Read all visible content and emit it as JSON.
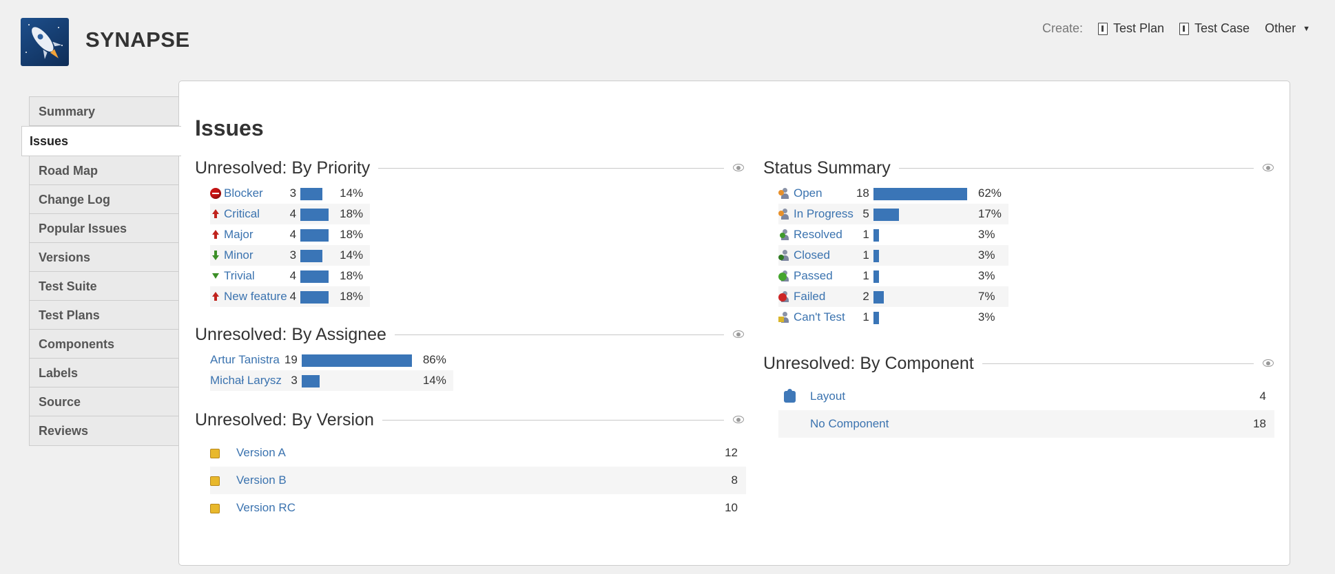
{
  "header": {
    "app_title": "SYNAPSE",
    "create_label": "Create:",
    "create_items": [
      {
        "label": "Test Plan",
        "icon": "document-icon"
      },
      {
        "label": "Test Case",
        "icon": "document-icon"
      }
    ],
    "other_label": "Other"
  },
  "sidebar": {
    "items": [
      {
        "label": "Summary"
      },
      {
        "label": "Issues",
        "active": true
      },
      {
        "label": "Road Map"
      },
      {
        "label": "Change Log"
      },
      {
        "label": "Popular Issues"
      },
      {
        "label": "Versions"
      },
      {
        "label": "Test Suite"
      },
      {
        "label": "Test Plans"
      },
      {
        "label": "Components"
      },
      {
        "label": "Labels"
      },
      {
        "label": "Source"
      },
      {
        "label": "Reviews"
      }
    ]
  },
  "main": {
    "title": "Issues",
    "by_priority": {
      "title": "Unresolved: By Priority",
      "rows": [
        {
          "label": "Blocker",
          "icon": "blocker-icon",
          "count": "3",
          "pct": "14%",
          "fraction": 0.14
        },
        {
          "label": "Critical",
          "icon": "critical-icon",
          "count": "4",
          "pct": "18%",
          "fraction": 0.18
        },
        {
          "label": "Major",
          "icon": "major-icon",
          "count": "4",
          "pct": "18%",
          "fraction": 0.18
        },
        {
          "label": "Minor",
          "icon": "minor-icon",
          "count": "3",
          "pct": "14%",
          "fraction": 0.14
        },
        {
          "label": "Trivial",
          "icon": "trivial-icon",
          "count": "4",
          "pct": "18%",
          "fraction": 0.18
        },
        {
          "label": "New feature",
          "icon": "new-feature-icon",
          "count": "4",
          "pct": "18%",
          "fraction": 0.18
        }
      ]
    },
    "by_assignee": {
      "title": "Unresolved: By Assignee",
      "rows": [
        {
          "label": "Artur Tanistra",
          "count": "19",
          "pct": "86%",
          "fraction": 0.86
        },
        {
          "label": "Michał Larysz",
          "count": "3",
          "pct": "14%",
          "fraction": 0.14
        }
      ]
    },
    "by_version": {
      "title": "Unresolved: By Version",
      "rows": [
        {
          "label": "Version A",
          "count": "12"
        },
        {
          "label": "Version B",
          "count": "8"
        },
        {
          "label": "Version RC",
          "count": "10"
        }
      ]
    },
    "status_summary": {
      "title": "Status Summary",
      "rows": [
        {
          "label": "Open",
          "icon": "open-icon",
          "count": "18",
          "pct": "62%",
          "fraction": 0.62
        },
        {
          "label": "In Progress",
          "icon": "in-progress-icon",
          "count": "5",
          "pct": "17%",
          "fraction": 0.17
        },
        {
          "label": "Resolved",
          "icon": "resolved-icon",
          "count": "1",
          "pct": "3%",
          "fraction": 0.03
        },
        {
          "label": "Closed",
          "icon": "closed-icon",
          "count": "1",
          "pct": "3%",
          "fraction": 0.03
        },
        {
          "label": "Passed",
          "icon": "passed-icon",
          "count": "1",
          "pct": "3%",
          "fraction": 0.03
        },
        {
          "label": "Failed",
          "icon": "failed-icon",
          "count": "2",
          "pct": "7%",
          "fraction": 0.07
        },
        {
          "label": "Can't Test",
          "icon": "cant-test-icon",
          "count": "1",
          "pct": "3%",
          "fraction": 0.03
        }
      ]
    },
    "by_component": {
      "title": "Unresolved: By Component",
      "rows": [
        {
          "label": "Layout",
          "count": "4",
          "icon": "component-icon"
        },
        {
          "label": "No Component",
          "count": "18"
        }
      ]
    }
  },
  "colors": {
    "bar": "#3a75b7",
    "link": "#3b73af"
  }
}
